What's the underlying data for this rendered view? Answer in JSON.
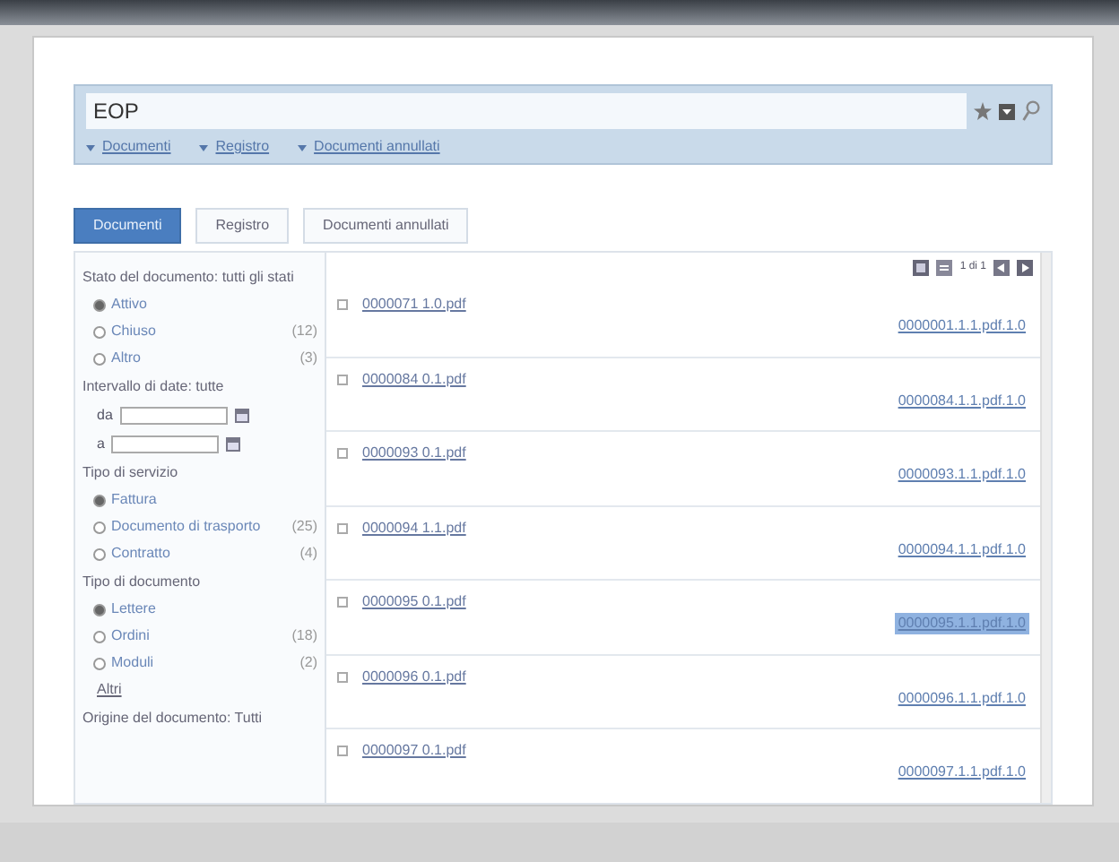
{
  "search": {
    "value": "EOP"
  },
  "breadcrumbs": [
    {
      "label": "Documenti"
    },
    {
      "label": "Registro"
    },
    {
      "label": "Documenti annullati"
    }
  ],
  "tabs": [
    {
      "label": "Documenti",
      "selected": true
    },
    {
      "label": "Registro",
      "selected": false
    },
    {
      "label": "Documenti annullati",
      "selected": false
    }
  ],
  "filters": [
    {
      "title": "Stato del documento: tutti gli stati",
      "options": [
        {
          "label": "Attivo",
          "selected": true
        },
        {
          "label": "Chiuso",
          "count": "(12)",
          "selected": false
        },
        {
          "label": "Altro",
          "count": "(3)",
          "selected": false
        }
      ]
    },
    {
      "title": "Intervallo di date: tutte",
      "kind": "dates",
      "fields": [
        {
          "label": "da"
        },
        {
          "label": "a"
        }
      ]
    },
    {
      "title": "Tipo di servizio",
      "options": [
        {
          "label": "Fattura",
          "selected": true
        },
        {
          "label": "Documento di trasporto",
          "count": "(25)",
          "selected": false
        },
        {
          "label": "Contratto",
          "count": "(4)",
          "selected": false
        }
      ]
    },
    {
      "title": "Tipo di documento",
      "options": [
        {
          "label": "Lettere",
          "selected": true
        },
        {
          "label": "Ordini",
          "count": "(18)",
          "selected": false
        },
        {
          "label": "Moduli",
          "count": "(2)",
          "selected": false
        }
      ],
      "more": "Altri"
    },
    {
      "title": "Origine del documento: Tutti"
    }
  ],
  "pager": "1 di 1",
  "documents": [
    {
      "name": "0000071 1.0.pdf",
      "link": "0000001.1.1.pdf.1.0",
      "checked": false,
      "selected": false
    },
    {
      "name": "0000084 0.1.pdf",
      "link": "0000084.1.1.pdf.1.0",
      "checked": false,
      "selected": false
    },
    {
      "name": "0000093 0.1.pdf",
      "link": "0000093.1.1.pdf.1.0",
      "checked": false,
      "selected": false
    },
    {
      "name": "0000094 1.1.pdf",
      "link": "0000094.1.1.pdf.1.0",
      "checked": false,
      "selected": false
    },
    {
      "name": "0000095 0.1.pdf",
      "link": "0000095.1.1.pdf.1.0",
      "checked": false,
      "selected": true
    },
    {
      "name": "0000096 0.1.pdf",
      "link": "0000096.1.1.pdf.1.0",
      "checked": false,
      "selected": false
    },
    {
      "name": "0000097 0.1.pdf",
      "link": "0000097.1.1.pdf.1.0",
      "checked": false,
      "selected": false
    }
  ]
}
